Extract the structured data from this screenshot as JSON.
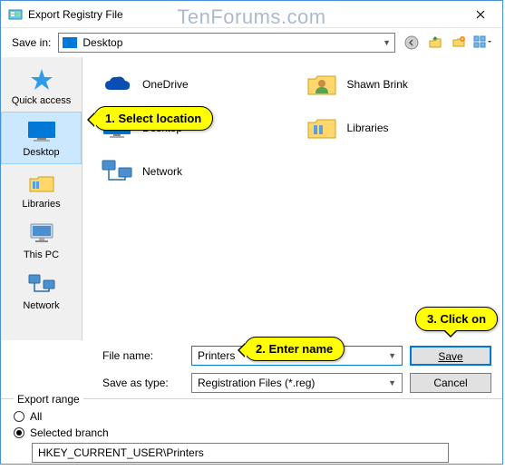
{
  "window": {
    "title": "Export Registry File"
  },
  "watermark": "TenForums.com",
  "toolbar": {
    "save_in_label": "Save in:",
    "save_in_value": "Desktop"
  },
  "places": [
    {
      "label": "Quick access"
    },
    {
      "label": "Desktop"
    },
    {
      "label": "Libraries"
    },
    {
      "label": "This PC"
    },
    {
      "label": "Network"
    }
  ],
  "files": [
    {
      "label": "OneDrive"
    },
    {
      "label": "Shawn Brink"
    },
    {
      "label": "Desktop"
    },
    {
      "label": "Libraries"
    },
    {
      "label": "Network"
    }
  ],
  "bottom": {
    "file_name_label": "File name:",
    "file_name_value": "Printers",
    "save_as_type_label": "Save as type:",
    "save_as_type_value": "Registration Files (*.reg)",
    "save_button": "Save",
    "cancel_button": "Cancel"
  },
  "export_range": {
    "legend": "Export range",
    "all_label": "All",
    "selected_label": "Selected branch",
    "branch_value": "HKEY_CURRENT_USER\\Printers"
  },
  "callouts": {
    "c1": "1. Select location",
    "c2": "2. Enter name",
    "c3": "3. Click on"
  }
}
